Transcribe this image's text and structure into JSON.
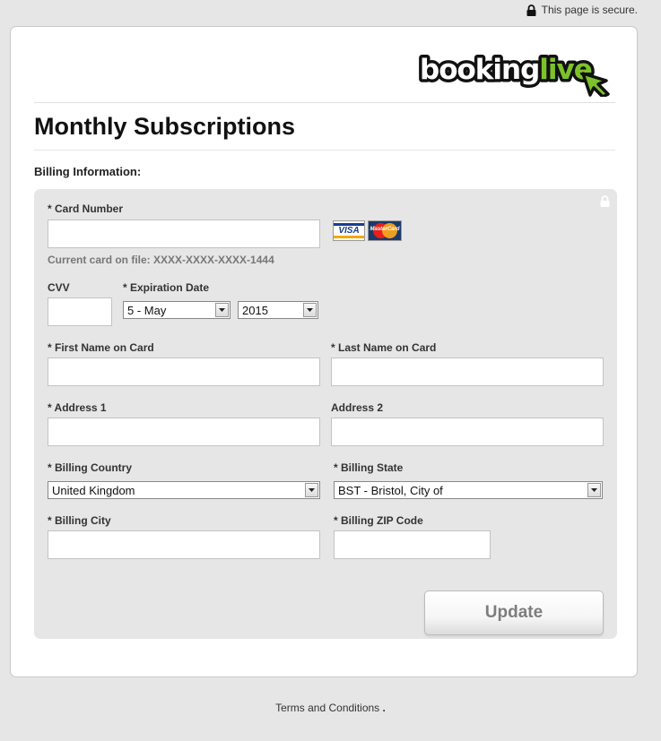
{
  "header": {
    "secure_text": "This page is secure."
  },
  "brand": {
    "logo_text_a": "booking",
    "logo_text_b": "live",
    "accent_color": "#7dc22a"
  },
  "page": {
    "title": "Monthly Subscriptions",
    "section_label": "Billing Information:"
  },
  "form": {
    "card_number_label": "* Card Number",
    "card_number_value": "",
    "card_on_file_note": "Current card on file: XXXX-XXXX-XXXX-1444",
    "card_brands": [
      "VISA",
      "MasterCard"
    ],
    "cvv_label": "CVV",
    "cvv_value": "",
    "expiration_label": "* Expiration Date",
    "exp_month": "5 - May",
    "exp_year": "2015",
    "first_name_label": "* First Name on Card",
    "first_name_value": "",
    "last_name_label": "* Last Name on Card",
    "last_name_value": "",
    "address1_label": "* Address 1",
    "address1_value": "",
    "address2_label": "Address 2",
    "address2_value": "",
    "country_label": "* Billing Country",
    "country_value": "United Kingdom",
    "state_label": "* Billing State",
    "state_value": "BST - Bristol, City of",
    "city_label": "* Billing City",
    "city_value": "",
    "zip_label": "* Billing ZIP Code",
    "zip_value": "",
    "update_label": "Update"
  },
  "footer": {
    "terms_label": "Terms and Conditions",
    "terms_dot": "."
  }
}
